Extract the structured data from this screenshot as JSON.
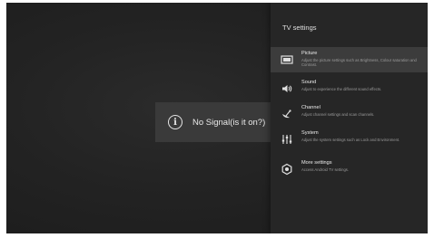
{
  "no_signal": {
    "message": "No Signal(is it on?)"
  },
  "panel": {
    "title": "TV settings",
    "items": [
      {
        "title": "Picture",
        "description": "Adjust the picture settings such as Brightness, Colour saturation and Contrast.",
        "icon": "picture-icon",
        "selected": true
      },
      {
        "title": "Sound",
        "description": "Adjust to experience the different sound effects.",
        "icon": "speaker-icon",
        "selected": false
      },
      {
        "title": "Channel",
        "description": "Adjust channel settings and scan channels.",
        "icon": "satellite-dish-icon",
        "selected": false
      },
      {
        "title": "System",
        "description": "Adjust the system settings such as Lock and Environment.",
        "icon": "sliders-icon",
        "selected": false
      },
      {
        "title": "More settings",
        "description": "Access Android TV settings.",
        "icon": "gear-icon",
        "selected": false
      }
    ]
  },
  "colors": {
    "background": "#232323",
    "panel": "#262626",
    "selected_row": "#3c3c3c",
    "no_signal_box": "#3a3a3a"
  }
}
